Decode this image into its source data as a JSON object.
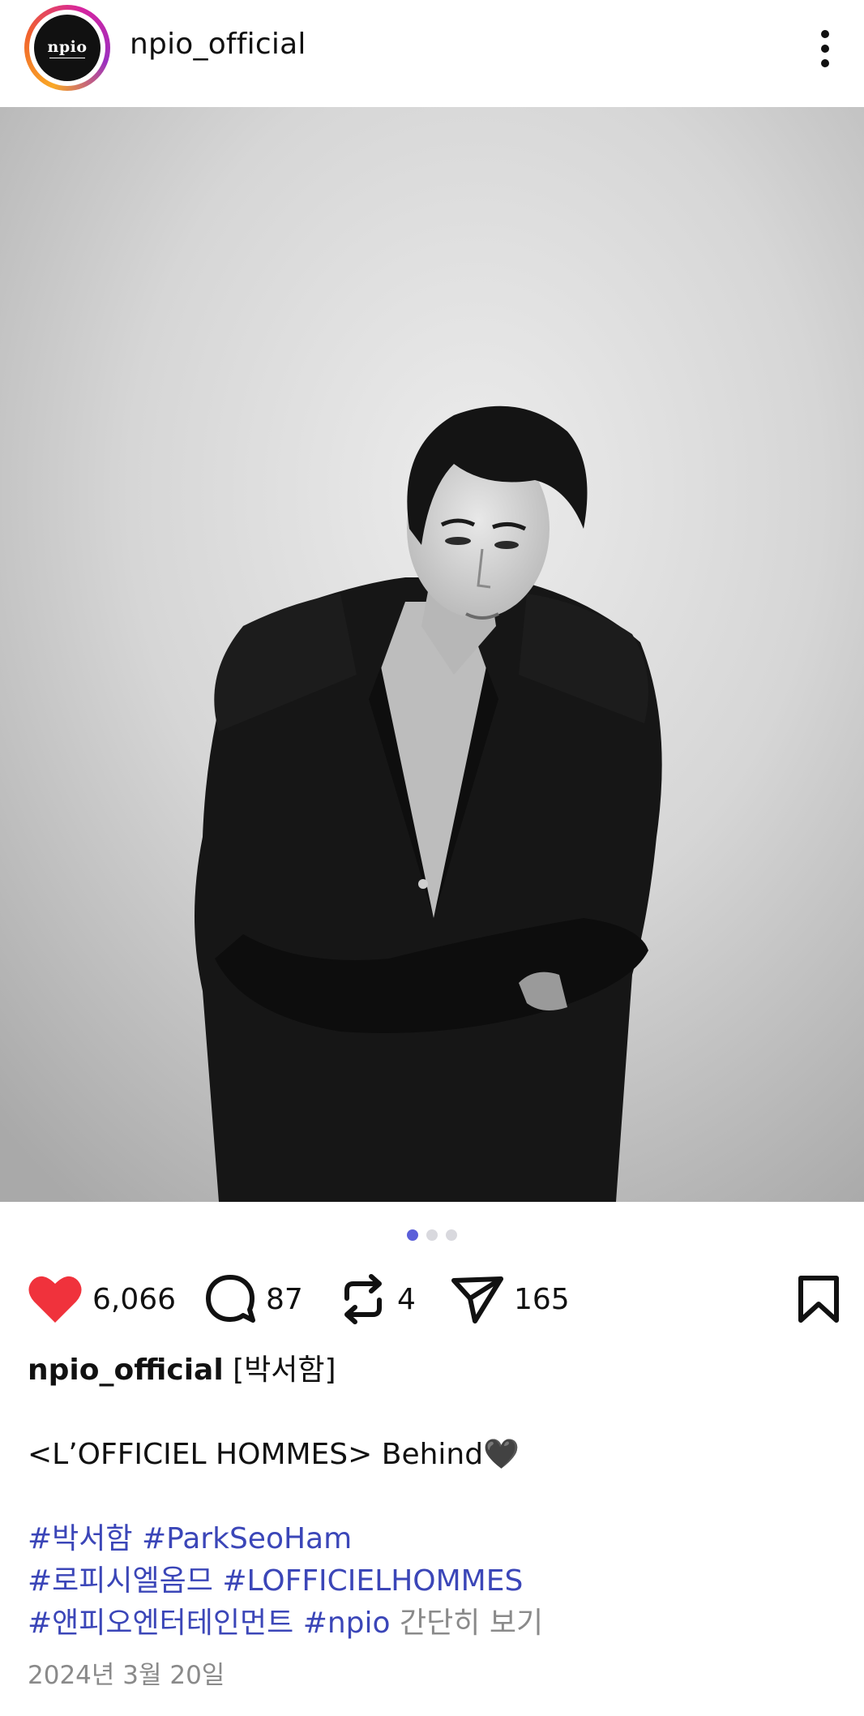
{
  "header": {
    "username": "npio_official",
    "avatar_text": "npio",
    "ring_colors": [
      "#f9a825",
      "#f0612d",
      "#d6249f",
      "#9b2fc0"
    ]
  },
  "icons": {
    "more": "more-vertical-icon",
    "like": "heart-icon",
    "comment": "comment-icon",
    "repost": "repost-icon",
    "share": "send-icon",
    "save": "bookmark-icon"
  },
  "carousel": {
    "total": 3,
    "active_index": 0,
    "active_color": "#5b5fd9"
  },
  "actions": {
    "likes": "6,066",
    "comments": "87",
    "reposts": "4",
    "shares": "165",
    "like_color": "#f0323c"
  },
  "caption": {
    "author": "npio_official",
    "line1": "[박서함]",
    "line2": "<L’OFFICIEL HOMMES> Behind🖤",
    "tags_row1": [
      "#박서함",
      "#ParkSeoHam"
    ],
    "tags_row2": [
      "#로피시엘옴므",
      "#LOFFICIELHOMMES"
    ],
    "tags_row3": [
      "#앤피오엔터테인먼트",
      "#npio"
    ],
    "more_label": "간단히 보기",
    "tag_color": "#3b46b8"
  },
  "date": "2024년 3월 20일"
}
